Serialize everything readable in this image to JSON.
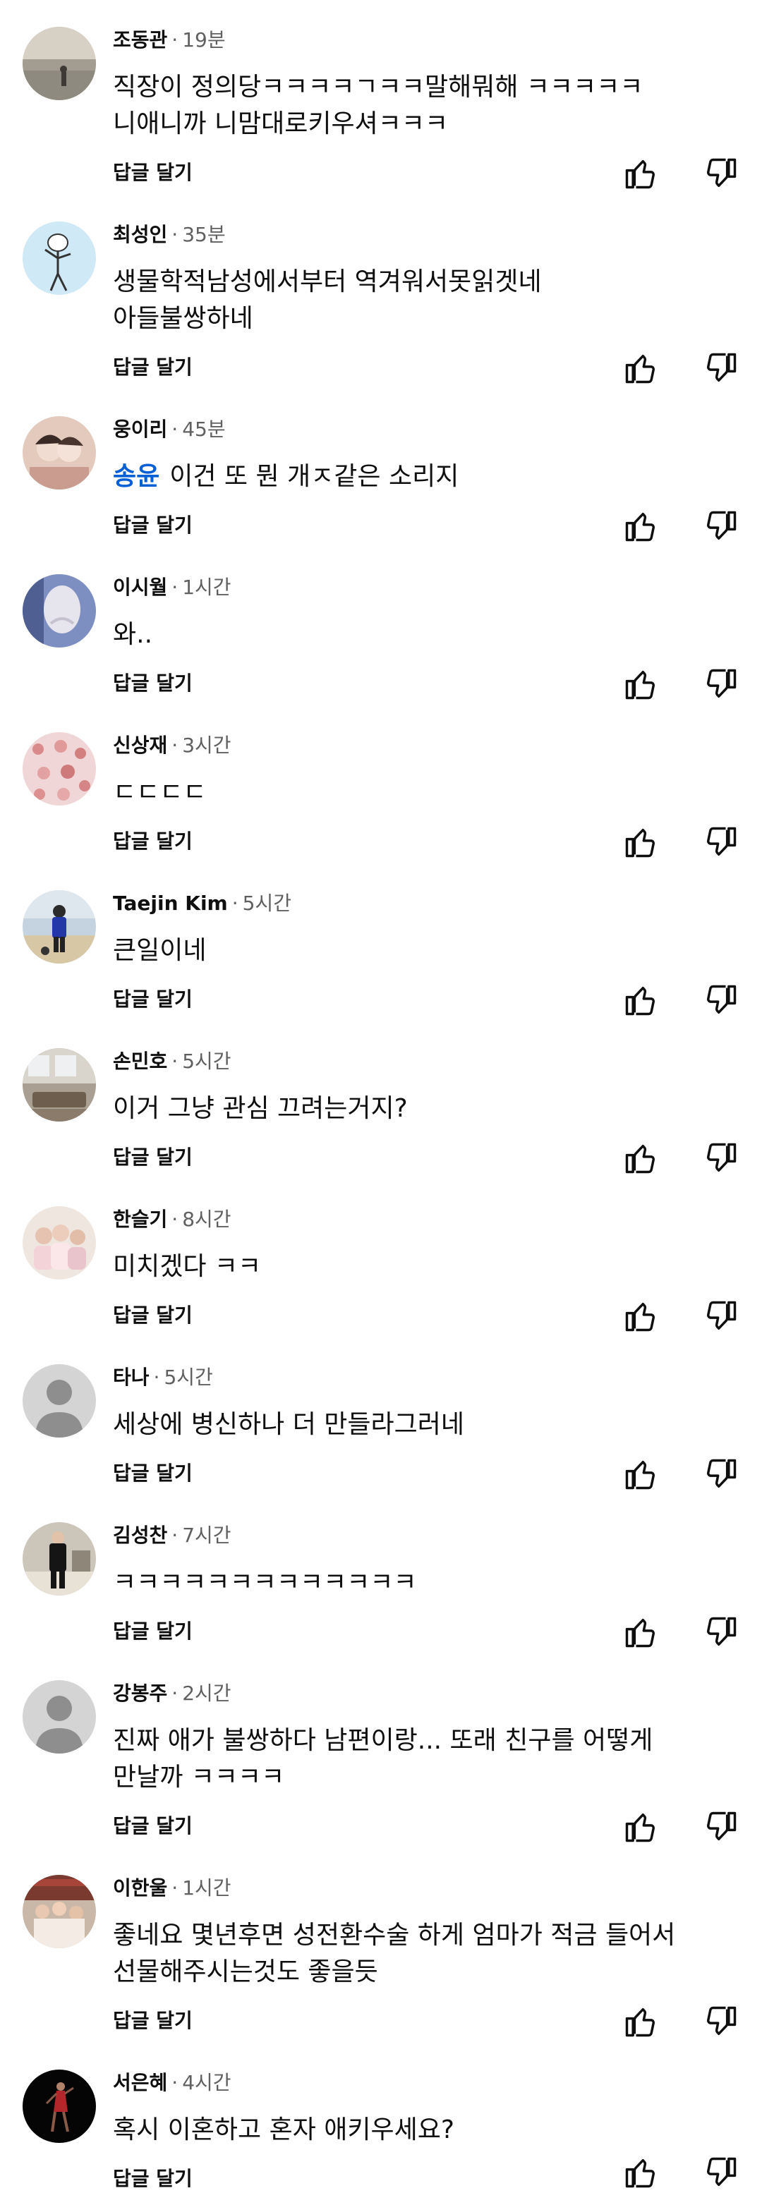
{
  "reply_label": "답글 달기",
  "comments": [
    {
      "author": "조동관",
      "time": "19분",
      "text": "직장이 정의당ㅋㅋㅋㅋㄱㅋㅋ말해뭐해 ㅋㅋㅋㅋㅋ\n니애니까 니맘대로키우셔ㅋㅋㅋ",
      "avatar": "sunset-photo"
    },
    {
      "author": "최성인",
      "time": "35분",
      "text": "생물학적남성에서부터 역겨워서못읽겟네\n아들불쌍하네",
      "avatar": "cartoon-figure"
    },
    {
      "author": "웅이리",
      "time": "45분",
      "mention": "송윤",
      "text": "이건 또 뭔 개ㅈ같은 소리지",
      "avatar": "couple-photo"
    },
    {
      "author": "이시월",
      "time": "1시간",
      "text": "와..",
      "avatar": "neck-photo"
    },
    {
      "author": "신상재",
      "time": "3시간",
      "text": "ㄷㄷㄷㄷ",
      "avatar": "pink-pattern"
    },
    {
      "author": "Taejin Kim",
      "time": "5시간",
      "text": "큰일이네",
      "avatar": "beach-person-photo"
    },
    {
      "author": "손민호",
      "time": "5시간",
      "text": "이거 그냥 관심 끄려는거지?",
      "avatar": "room-photo"
    },
    {
      "author": "한슬기",
      "time": "8시간",
      "text": "미치겠다 ㅋㅋ",
      "avatar": "family-photo"
    },
    {
      "author": "타나",
      "time": "5시간",
      "text": "세상에 병신하나 더 만들라그러네",
      "avatar": "default-avatar"
    },
    {
      "author": "김성찬",
      "time": "7시간",
      "text": "ㅋㅋㅋㅋㅋㅋㅋㅋㅋㅋㅋㅋㅋ",
      "avatar": "suit-man-photo"
    },
    {
      "author": "강봉주",
      "time": "2시간",
      "text": "진짜 애가 불쌍하다 남편이랑... 또래 친구를 어떻게\n만날까 ㅋㅋㅋㅋ",
      "avatar": "default-avatar"
    },
    {
      "author": "이한울",
      "time": "1시간",
      "text": "좋네요 몇년후면 성전환수술 하게 엄마가 적금 들어서\n선물해주시는것도 좋을듯",
      "avatar": "group-photo"
    },
    {
      "author": "서은혜",
      "time": "4시간",
      "text": "혹시 이혼하고 혼자 애키우세요?",
      "avatar": "dancer-photo"
    }
  ],
  "icons": {
    "like": "thumbs-up-icon",
    "dislike": "thumbs-down-icon"
  },
  "colors": {
    "mention": "#065fd4",
    "meta": "#606060",
    "text": "#0f0f0f",
    "default_avatar_bg": "#d4d4d4",
    "default_avatar_fg": "#8e8e8e"
  }
}
